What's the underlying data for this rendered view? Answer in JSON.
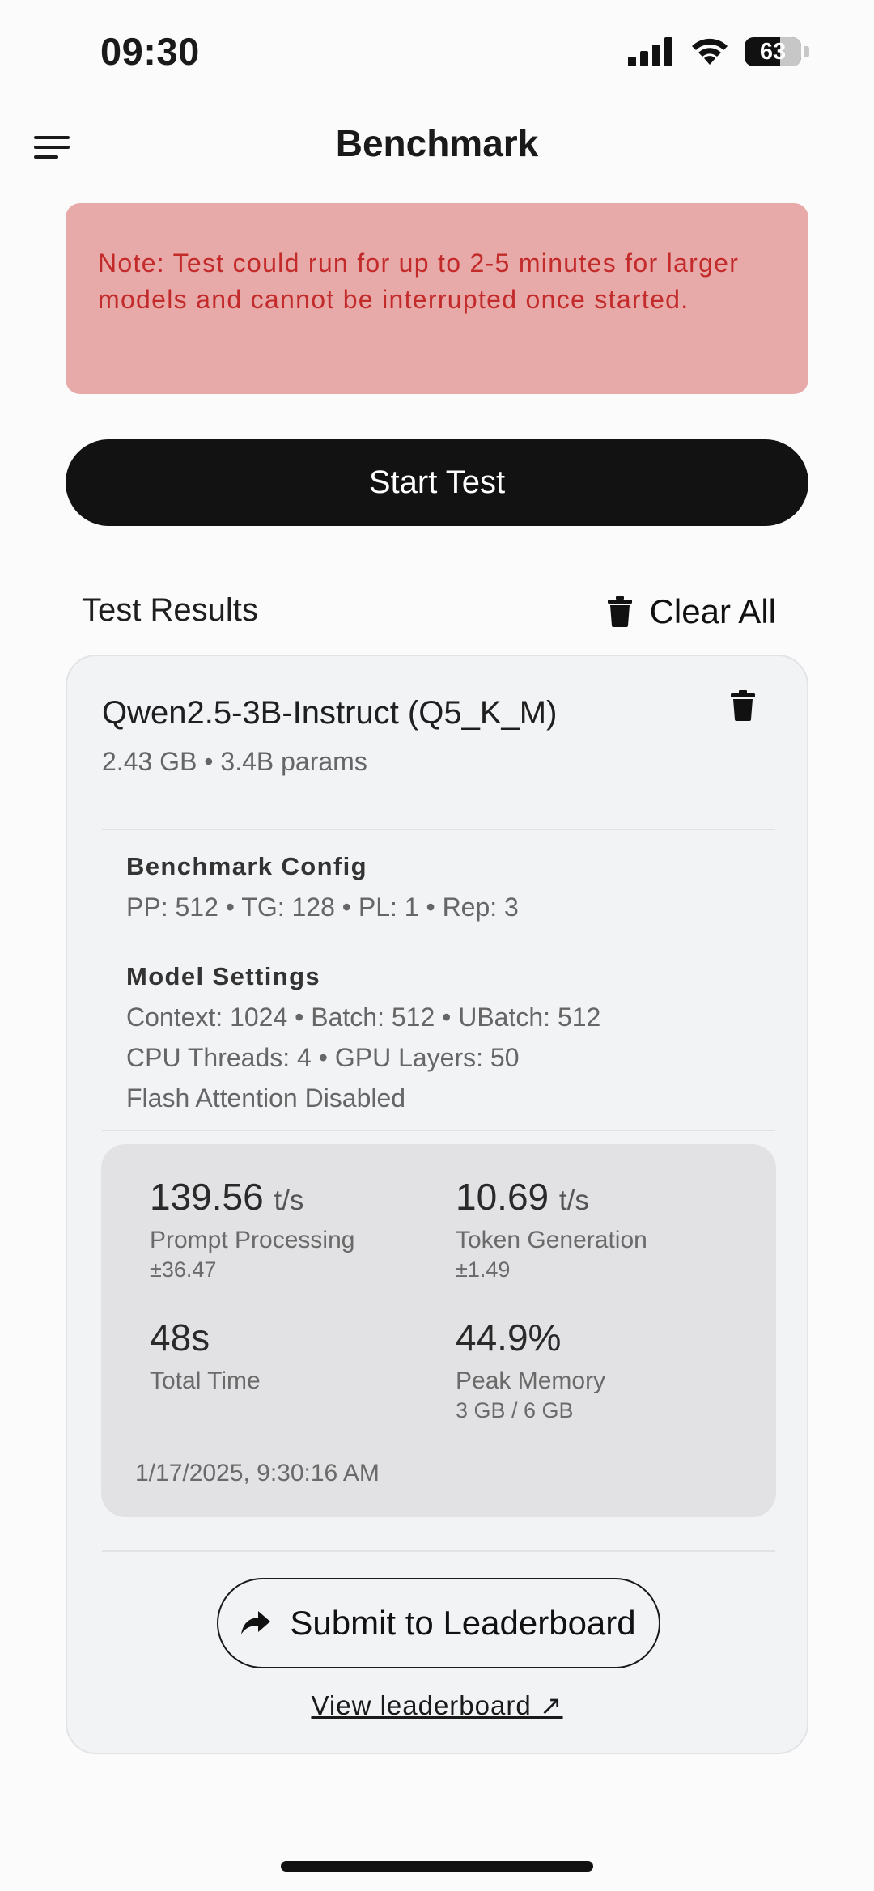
{
  "status_bar": {
    "time": "09:30",
    "battery": "63"
  },
  "header": {
    "title": "Benchmark",
    "menu_icon": "hamburger-menu-icon"
  },
  "note": {
    "text": "Note: Test could run for up to 2-5 minutes for larger models and cannot be interrupted once started."
  },
  "start_button": {
    "label": "Start Test"
  },
  "results": {
    "title": "Test Results",
    "clear_all_label": "Clear All",
    "clear_icon": "trash-icon"
  },
  "result_card": {
    "model_name": "Qwen2.5-3B-Instruct (Q5_K_M)",
    "model_meta": "2.43 GB • 3.4B params",
    "benchmark_config": {
      "title": "Benchmark Config",
      "line": "PP: 512 • TG: 128 • PL: 1 • Rep: 3"
    },
    "model_settings": {
      "title": "Model Settings",
      "line1": "Context: 1024 • Batch: 512 • UBatch: 512",
      "line2": "CPU Threads: 4 • GPU Layers: 50",
      "line3": "Flash Attention Disabled"
    },
    "metrics": {
      "pp_value": "139.56",
      "pp_unit": "t/s",
      "pp_label": "Prompt Processing",
      "pp_sub": "±36.47",
      "tg_value": "10.69",
      "tg_unit": "t/s",
      "tg_label": "Token Generation",
      "tg_sub": "±1.49",
      "total_time_value": "48s",
      "total_time_label": "Total Time",
      "peak_memory_value": "44.9%",
      "peak_memory_label": "Peak Memory",
      "peak_memory_sub": "3 GB / 6 GB"
    },
    "timestamp": "1/17/2025, 9:30:16 AM",
    "submit_label": "Submit to Leaderboard",
    "submit_icon": "share-arrow-icon",
    "view_leaderboard": "View leaderboard ↗"
  },
  "colors": {
    "note_bg": "#e8a9a9",
    "note_text": "#c32a2a",
    "primary_button": "#121212",
    "card_bg": "#f2f3f5",
    "metrics_bg": "#e2e2e4"
  }
}
